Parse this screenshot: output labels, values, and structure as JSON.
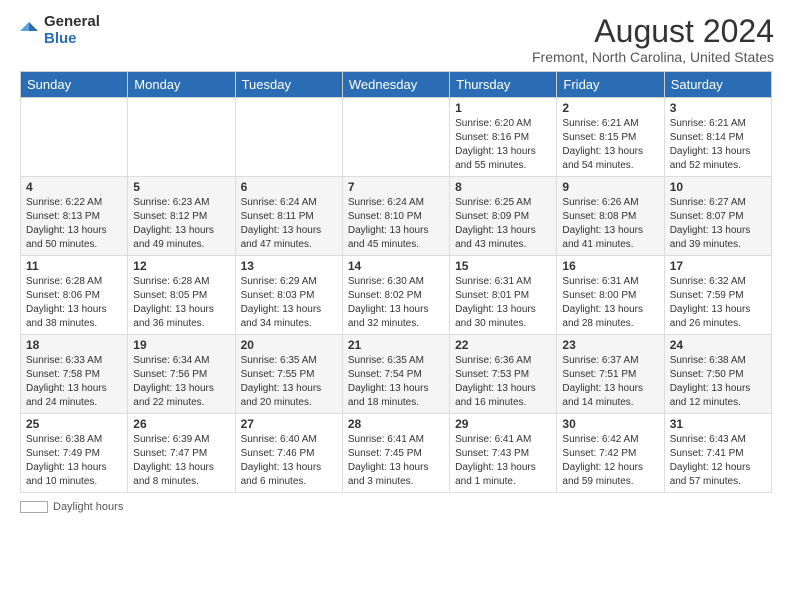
{
  "header": {
    "logo_general": "General",
    "logo_blue": "Blue",
    "main_title": "August 2024",
    "subtitle": "Fremont, North Carolina, United States"
  },
  "calendar": {
    "days_of_week": [
      "Sunday",
      "Monday",
      "Tuesday",
      "Wednesday",
      "Thursday",
      "Friday",
      "Saturday"
    ],
    "weeks": [
      [
        {
          "day": "",
          "info": ""
        },
        {
          "day": "",
          "info": ""
        },
        {
          "day": "",
          "info": ""
        },
        {
          "day": "",
          "info": ""
        },
        {
          "day": "1",
          "info": "Sunrise: 6:20 AM\nSunset: 8:16 PM\nDaylight: 13 hours\nand 55 minutes."
        },
        {
          "day": "2",
          "info": "Sunrise: 6:21 AM\nSunset: 8:15 PM\nDaylight: 13 hours\nand 54 minutes."
        },
        {
          "day": "3",
          "info": "Sunrise: 6:21 AM\nSunset: 8:14 PM\nDaylight: 13 hours\nand 52 minutes."
        }
      ],
      [
        {
          "day": "4",
          "info": "Sunrise: 6:22 AM\nSunset: 8:13 PM\nDaylight: 13 hours\nand 50 minutes."
        },
        {
          "day": "5",
          "info": "Sunrise: 6:23 AM\nSunset: 8:12 PM\nDaylight: 13 hours\nand 49 minutes."
        },
        {
          "day": "6",
          "info": "Sunrise: 6:24 AM\nSunset: 8:11 PM\nDaylight: 13 hours\nand 47 minutes."
        },
        {
          "day": "7",
          "info": "Sunrise: 6:24 AM\nSunset: 8:10 PM\nDaylight: 13 hours\nand 45 minutes."
        },
        {
          "day": "8",
          "info": "Sunrise: 6:25 AM\nSunset: 8:09 PM\nDaylight: 13 hours\nand 43 minutes."
        },
        {
          "day": "9",
          "info": "Sunrise: 6:26 AM\nSunset: 8:08 PM\nDaylight: 13 hours\nand 41 minutes."
        },
        {
          "day": "10",
          "info": "Sunrise: 6:27 AM\nSunset: 8:07 PM\nDaylight: 13 hours\nand 39 minutes."
        }
      ],
      [
        {
          "day": "11",
          "info": "Sunrise: 6:28 AM\nSunset: 8:06 PM\nDaylight: 13 hours\nand 38 minutes."
        },
        {
          "day": "12",
          "info": "Sunrise: 6:28 AM\nSunset: 8:05 PM\nDaylight: 13 hours\nand 36 minutes."
        },
        {
          "day": "13",
          "info": "Sunrise: 6:29 AM\nSunset: 8:03 PM\nDaylight: 13 hours\nand 34 minutes."
        },
        {
          "day": "14",
          "info": "Sunrise: 6:30 AM\nSunset: 8:02 PM\nDaylight: 13 hours\nand 32 minutes."
        },
        {
          "day": "15",
          "info": "Sunrise: 6:31 AM\nSunset: 8:01 PM\nDaylight: 13 hours\nand 30 minutes."
        },
        {
          "day": "16",
          "info": "Sunrise: 6:31 AM\nSunset: 8:00 PM\nDaylight: 13 hours\nand 28 minutes."
        },
        {
          "day": "17",
          "info": "Sunrise: 6:32 AM\nSunset: 7:59 PM\nDaylight: 13 hours\nand 26 minutes."
        }
      ],
      [
        {
          "day": "18",
          "info": "Sunrise: 6:33 AM\nSunset: 7:58 PM\nDaylight: 13 hours\nand 24 minutes."
        },
        {
          "day": "19",
          "info": "Sunrise: 6:34 AM\nSunset: 7:56 PM\nDaylight: 13 hours\nand 22 minutes."
        },
        {
          "day": "20",
          "info": "Sunrise: 6:35 AM\nSunset: 7:55 PM\nDaylight: 13 hours\nand 20 minutes."
        },
        {
          "day": "21",
          "info": "Sunrise: 6:35 AM\nSunset: 7:54 PM\nDaylight: 13 hours\nand 18 minutes."
        },
        {
          "day": "22",
          "info": "Sunrise: 6:36 AM\nSunset: 7:53 PM\nDaylight: 13 hours\nand 16 minutes."
        },
        {
          "day": "23",
          "info": "Sunrise: 6:37 AM\nSunset: 7:51 PM\nDaylight: 13 hours\nand 14 minutes."
        },
        {
          "day": "24",
          "info": "Sunrise: 6:38 AM\nSunset: 7:50 PM\nDaylight: 13 hours\nand 12 minutes."
        }
      ],
      [
        {
          "day": "25",
          "info": "Sunrise: 6:38 AM\nSunset: 7:49 PM\nDaylight: 13 hours\nand 10 minutes."
        },
        {
          "day": "26",
          "info": "Sunrise: 6:39 AM\nSunset: 7:47 PM\nDaylight: 13 hours\nand 8 minutes."
        },
        {
          "day": "27",
          "info": "Sunrise: 6:40 AM\nSunset: 7:46 PM\nDaylight: 13 hours\nand 6 minutes."
        },
        {
          "day": "28",
          "info": "Sunrise: 6:41 AM\nSunset: 7:45 PM\nDaylight: 13 hours\nand 3 minutes."
        },
        {
          "day": "29",
          "info": "Sunrise: 6:41 AM\nSunset: 7:43 PM\nDaylight: 13 hours\nand 1 minute."
        },
        {
          "day": "30",
          "info": "Sunrise: 6:42 AM\nSunset: 7:42 PM\nDaylight: 12 hours\nand 59 minutes."
        },
        {
          "day": "31",
          "info": "Sunrise: 6:43 AM\nSunset: 7:41 PM\nDaylight: 12 hours\nand 57 minutes."
        }
      ]
    ]
  },
  "legend": {
    "label": "Daylight hours"
  }
}
